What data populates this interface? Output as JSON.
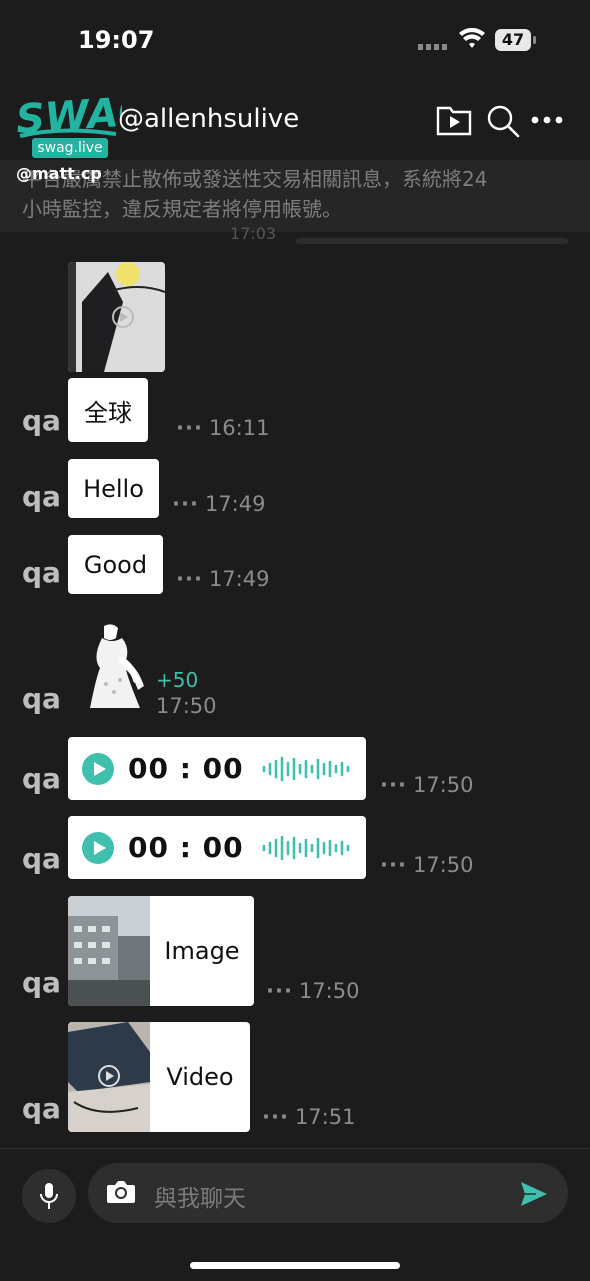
{
  "status_bar": {
    "time": "19:07",
    "battery": "47"
  },
  "header": {
    "logo_text": "SWAG",
    "logo_sub": "swag.live",
    "channel_name": "@allenhsulive",
    "overlay_handle": "@matt.cp",
    "icons": [
      "video-folder-icon",
      "search-icon",
      "more-icon"
    ]
  },
  "notice": {
    "line1": "平台嚴厲禁止散佈或發送性交易相關訊息，系統將24",
    "line2": "小時監控，違反規定者將停用帳號。",
    "faded_time": "17:03"
  },
  "messages": [
    {
      "type": "image",
      "sender": "",
      "time": ""
    },
    {
      "type": "text",
      "sender": "qa",
      "text": "全球",
      "time": "16:11"
    },
    {
      "type": "text",
      "sender": "qa",
      "text": "Hello",
      "time": "17:49"
    },
    {
      "type": "text",
      "sender": "qa",
      "text": "Good",
      "time": "17:49"
    },
    {
      "type": "gift",
      "sender": "qa",
      "amount": "+50",
      "time": "17:50"
    },
    {
      "type": "audio",
      "sender": "qa",
      "duration": "00 : 00",
      "time": "17:50"
    },
    {
      "type": "audio",
      "sender": "qa",
      "duration": "00 : 00",
      "time": "17:50"
    },
    {
      "type": "image",
      "sender": "qa",
      "label": "Image",
      "time": "17:50"
    },
    {
      "type": "video",
      "sender": "qa",
      "label": "Video",
      "time": "17:51"
    }
  ],
  "input": {
    "placeholder": "與我聊天"
  },
  "colors": {
    "accent": "#3fbfae",
    "background": "#1c1c1c",
    "bubble": "#ffffff"
  }
}
